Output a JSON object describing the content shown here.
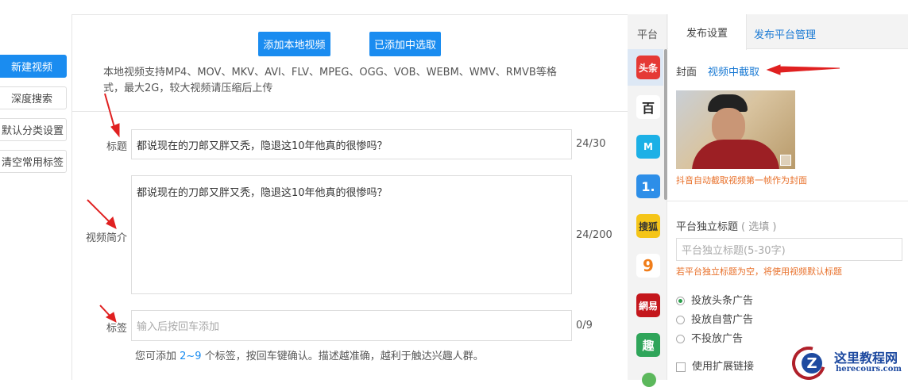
{
  "sidebar": {
    "items": [
      {
        "label": "新建视频",
        "active": true
      },
      {
        "label": "深度搜索"
      },
      {
        "label": "默认分类设置"
      },
      {
        "label": "清空常用标签"
      }
    ]
  },
  "main": {
    "add_local_label": "添加本地视频",
    "pick_added_label": "已添加中选取",
    "support_line1": "本地视频支持MP4、MOV、MKV、AVI、FLV、MPEG、OGG、VOB、WEBM、WMV、RMVB等格",
    "support_line2": "式，最大2G，较大视频请压缩后上传",
    "title_label": "标题",
    "title_value": "都说现在的刀郎又胖又秃，隐退这10年他真的很惨吗？",
    "title_count": "24/30",
    "desc_label": "视频简介",
    "desc_value": "都说现在的刀郎又胖又秃，隐退这10年他真的很惨吗？",
    "desc_count": "24/200",
    "tag_label": "标签",
    "tag_placeholder": "输入后按回车添加",
    "tag_count": "0/9",
    "tag_hint_pre": "您可添加 ",
    "tag_hint_range": "2~9",
    "tag_hint_post": " 个标签，按回车键确认。描述越准确，越利于触达兴趣人群。"
  },
  "platforms": {
    "header": "平台",
    "items": [
      {
        "name": "头条",
        "color": "#e53935"
      },
      {
        "name": "百",
        "color": "#ffffff"
      },
      {
        "name": "M",
        "color": "#1cb0e6"
      },
      {
        "name": "1.",
        "color": "#2d8ee8"
      },
      {
        "name": "搜狐",
        "color": "#f5c518"
      },
      {
        "name": "9",
        "color": "#ffffff"
      },
      {
        "name": "網易",
        "color": "#c4161c"
      },
      {
        "name": "趣",
        "color": "#2fa55a"
      }
    ]
  },
  "settings": {
    "tabs": [
      {
        "label": "发布设置",
        "active": true
      },
      {
        "label": "发布平台管理"
      }
    ],
    "cover_label": "封面",
    "cover_link": "视频中截取",
    "cover_note": "抖音自动截取视频第一帧作为封面",
    "indep_title_label": "平台独立标题",
    "indep_title_optional": "( 选填 )",
    "indep_title_placeholder": "平台独立标题(5-30字)",
    "indep_title_note": "若平台独立标题为空，将使用视频默认标题",
    "ad_options": [
      {
        "label": "投放头条广告",
        "selected": true
      },
      {
        "label": "投放自营广告",
        "selected": false
      },
      {
        "label": "不投放广告",
        "selected": false
      }
    ],
    "checkboxes": [
      {
        "label": "使用扩展链接",
        "checked": false
      }
    ]
  },
  "watermark": {
    "title": "这里教程网",
    "url": "herecours.com"
  }
}
